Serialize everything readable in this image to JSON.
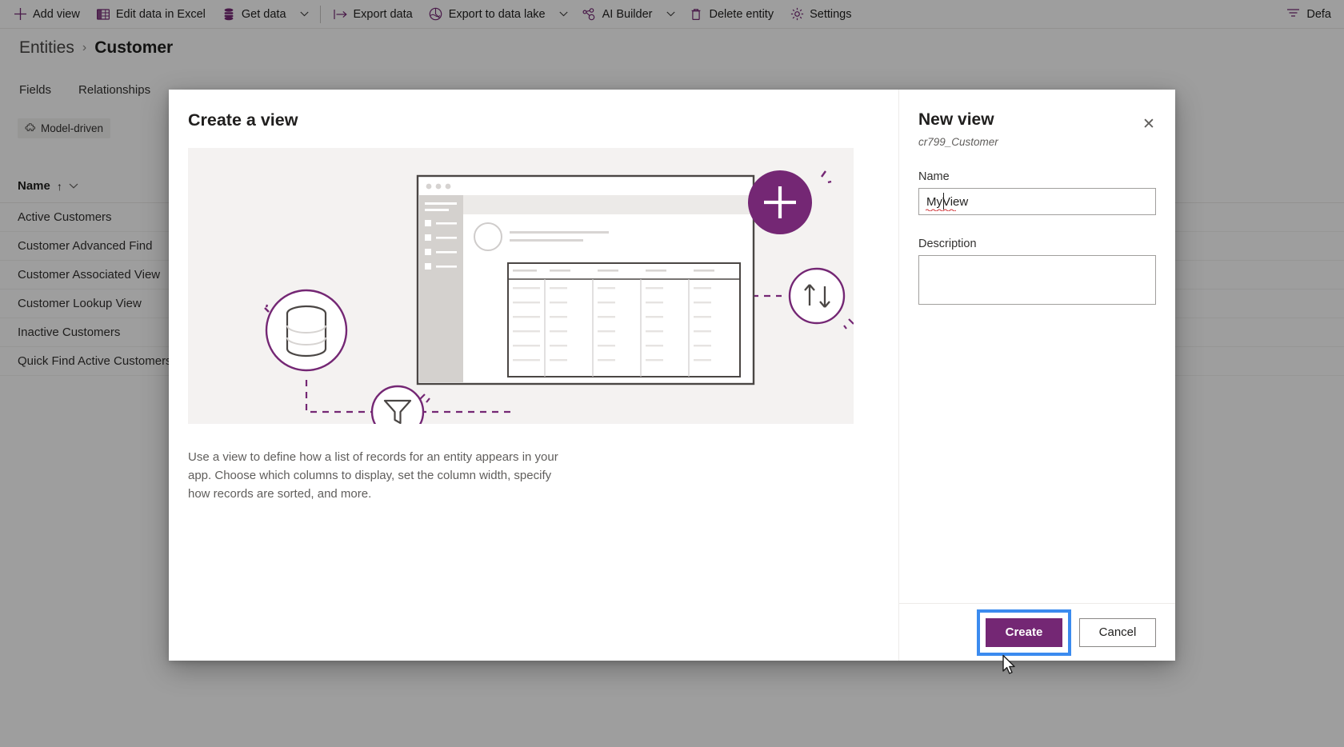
{
  "command_bar": {
    "items": [
      {
        "label": "Add view",
        "icon": "plus-icon",
        "caret": false
      },
      {
        "label": "Edit data in Excel",
        "icon": "excel-icon",
        "caret": false
      },
      {
        "label": "Get data",
        "icon": "database-icon",
        "caret": true
      },
      {
        "label": "Export data",
        "icon": "export-icon",
        "caret": false
      },
      {
        "label": "Export to data lake",
        "icon": "data-lake-icon",
        "caret": true
      },
      {
        "label": "AI Builder",
        "icon": "ai-builder-icon",
        "caret": true
      },
      {
        "label": "Delete entity",
        "icon": "trash-icon",
        "caret": false
      },
      {
        "label": "Settings",
        "icon": "gear-icon",
        "caret": false
      }
    ],
    "right_item": {
      "label": "Defa",
      "icon": "filter-list-icon"
    }
  },
  "breadcrumb": {
    "parent": "Entities",
    "separator": "›",
    "current": "Customer"
  },
  "tabs": [
    {
      "label": "Fields"
    },
    {
      "label": "Relationships"
    }
  ],
  "type_pill": {
    "label": "Model-driven",
    "icon": "puzzle-icon"
  },
  "list": {
    "header": {
      "label": "Name",
      "sort": "↑",
      "chevron": "⌄"
    },
    "rows": [
      {
        "name": "Active Customers"
      },
      {
        "name": "Customer Advanced Find"
      },
      {
        "name": "Customer Associated View"
      },
      {
        "name": "Customer Lookup View"
      },
      {
        "name": "Inactive Customers"
      },
      {
        "name": "Quick Find Active Customers"
      }
    ]
  },
  "dialog": {
    "title": "Create a view",
    "description": "Use a view to define how a list of records for an entity appears in your app. Choose which columns to display, set the column width, specify how records are sorted, and more.",
    "illustration": {
      "database_icon": "database-circle-icon",
      "filter_icon": "funnel-circle-icon",
      "add_icon": "plus-circle-icon",
      "sort_icon": "sort-updown-circle-icon"
    },
    "panel": {
      "title": "New view",
      "subtitle": "cr799_Customer",
      "close_label": "✕",
      "name_label": "Name",
      "name_value": "MyView",
      "name_placeholder": "",
      "description_label": "Description",
      "description_value": "",
      "description_placeholder": ""
    },
    "footer": {
      "create_label": "Create",
      "cancel_label": "Cancel"
    }
  },
  "colors": {
    "brand_purple": "#742774",
    "focus_blue": "#3b8bef",
    "illustration_bg": "#f4f2f1"
  }
}
